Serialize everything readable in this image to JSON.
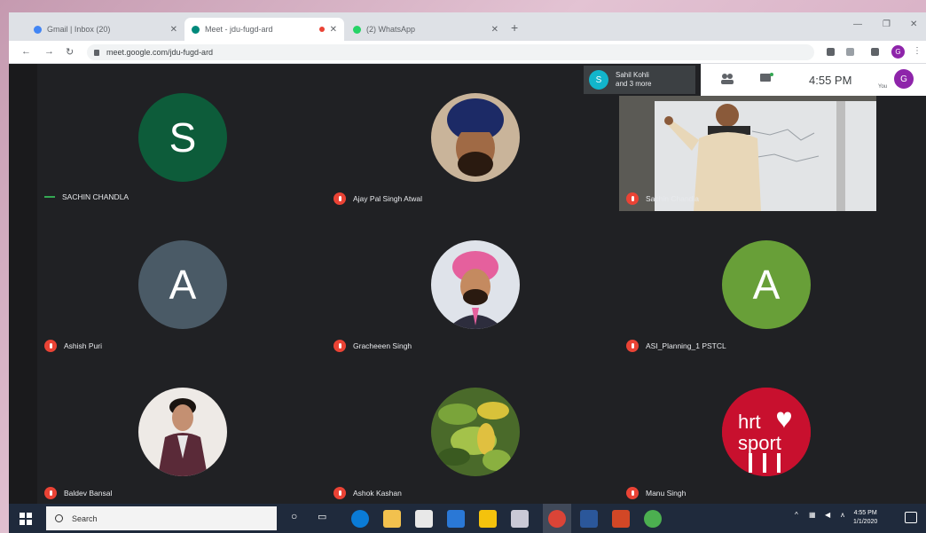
{
  "browser": {
    "tabs": [
      {
        "label": "Gmail | Inbox (20)",
        "favicon_color": "#4285f4",
        "active": false
      },
      {
        "label": "Meet - jdu-fugd-ard",
        "favicon_color": "#00897b",
        "active": true,
        "recording": true
      },
      {
        "label": "(2) WhatsApp",
        "favicon_color": "#25d366",
        "active": false
      }
    ],
    "new_tab": "+",
    "url": "meet.google.com/jdu-fugd-ard",
    "profile_initial": "G"
  },
  "meet": {
    "joined_notice": {
      "avatar": "S",
      "line1": "Sahil Kohli",
      "line2": "and 3 more"
    },
    "clock": "4:55 PM",
    "self_avatar": "G",
    "self_label": "You",
    "participants": [
      {
        "name": "SACHIN CHANDLA",
        "kind": "letter",
        "letter": "S",
        "color": "#0d5c3a",
        "muted": false
      },
      {
        "name": "Ajay Pal Singh Atwal",
        "kind": "photo",
        "photo": "turban-man",
        "muted": true
      },
      {
        "name": "Sachin Chandla",
        "kind": "video",
        "muted": true
      },
      {
        "name": "Ashish Puri",
        "kind": "letter",
        "letter": "A",
        "color": "#4a5a66",
        "muted": true
      },
      {
        "name": "Gracheeen Singh",
        "kind": "photo",
        "photo": "pink-turban",
        "muted": true
      },
      {
        "name": "ASI_Planning_1 PSTCL",
        "kind": "letter",
        "letter": "A",
        "color": "#689f38",
        "muted": true
      },
      {
        "name": "Baldev Bansal",
        "kind": "photo",
        "photo": "young-man",
        "muted": true
      },
      {
        "name": "Ashok Kashan",
        "kind": "photo",
        "photo": "nature",
        "muted": true
      },
      {
        "name": "Manu Singh",
        "kind": "photo",
        "photo": "hrt-sport-logo",
        "logo_text": "hrt sport",
        "muted": true
      }
    ]
  },
  "taskbar": {
    "search_placeholder": "Search",
    "time": "4:55 PM",
    "date": "1/1/2020"
  }
}
